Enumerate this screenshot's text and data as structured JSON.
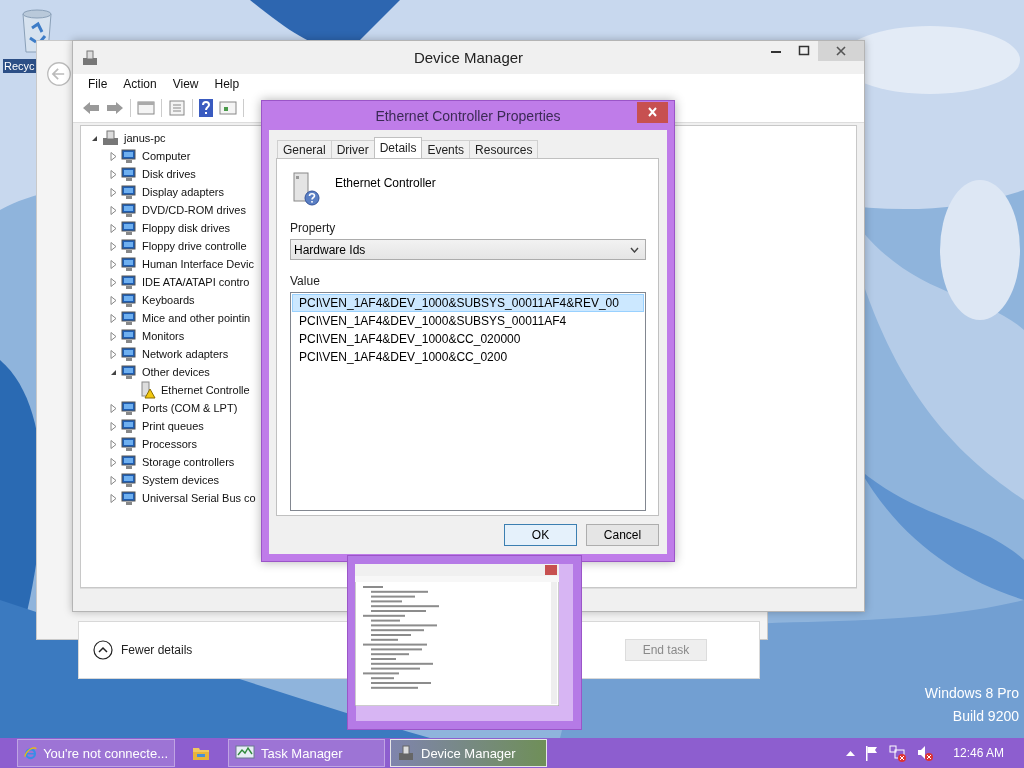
{
  "desktop": {
    "icons": [
      {
        "label": "Recyc"
      }
    ],
    "edition": "Windows 8 Pro",
    "build": "Build 9200"
  },
  "task_manager": {
    "details_toggle": "Fewer details",
    "end_task": {
      "label": "End task",
      "disabled": true
    }
  },
  "device_manager": {
    "title": "Device Manager",
    "menu": [
      "File",
      "Action",
      "View",
      "Help"
    ],
    "tree": {
      "label": "janus-pc",
      "expanded": true,
      "children": [
        {
          "label": "Computer",
          "expanded": false
        },
        {
          "label": "Disk drives",
          "expanded": false
        },
        {
          "label": "Display adapters",
          "expanded": false
        },
        {
          "label": "DVD/CD-ROM drives",
          "expanded": false
        },
        {
          "label": "Floppy disk drives",
          "expanded": false
        },
        {
          "label": "Floppy drive controlle",
          "expanded": false
        },
        {
          "label": "Human Interface Devic",
          "expanded": false
        },
        {
          "label": "IDE ATA/ATAPI contro",
          "expanded": false
        },
        {
          "label": "Keyboards",
          "expanded": false
        },
        {
          "label": "Mice and other pointin",
          "expanded": false
        },
        {
          "label": "Monitors",
          "expanded": false
        },
        {
          "label": "Network adapters",
          "expanded": false
        },
        {
          "label": "Other devices",
          "expanded": true,
          "children": [
            {
              "label": "Ethernet Controlle",
              "warning": true
            }
          ]
        },
        {
          "label": "Ports (COM & LPT)",
          "expanded": false
        },
        {
          "label": "Print queues",
          "expanded": false
        },
        {
          "label": "Processors",
          "expanded": false
        },
        {
          "label": "Storage controllers",
          "expanded": false
        },
        {
          "label": "System devices",
          "expanded": false
        },
        {
          "label": "Universal Serial Bus co",
          "expanded": false
        }
      ]
    }
  },
  "properties_dialog": {
    "title": "Ethernet Controller Properties",
    "tabs": [
      {
        "label": "General",
        "selected": false
      },
      {
        "label": "Driver",
        "selected": false
      },
      {
        "label": "Details",
        "selected": true
      },
      {
        "label": "Events",
        "selected": false
      },
      {
        "label": "Resources",
        "selected": false
      }
    ],
    "device_name": "Ethernet Controller",
    "property_label": "Property",
    "property": "Hardware Ids",
    "value_label": "Value",
    "values": [
      {
        "text": "PCI\\VEN_1AF4&DEV_1000&SUBSYS_00011AF4&REV_00",
        "selected": true
      },
      {
        "text": "PCI\\VEN_1AF4&DEV_1000&SUBSYS_00011AF4",
        "selected": false
      },
      {
        "text": "PCI\\VEN_1AF4&DEV_1000&CC_020000",
        "selected": false
      },
      {
        "text": "PCI\\VEN_1AF4&DEV_1000&CC_0200",
        "selected": false
      }
    ],
    "buttons": [
      {
        "label": "OK",
        "default": true
      },
      {
        "label": "Cancel",
        "default": false
      }
    ]
  },
  "taskbar": {
    "items": [
      {
        "kind": "browser",
        "label": "You're not connecte...",
        "selected": false
      },
      {
        "kind": "folder",
        "selected": false
      },
      {
        "kind": "monitor",
        "label": "Task Manager",
        "selected": false
      },
      {
        "kind": "device",
        "label": "Device Manager",
        "selected": true
      }
    ],
    "clock": "12:46 AM"
  }
}
